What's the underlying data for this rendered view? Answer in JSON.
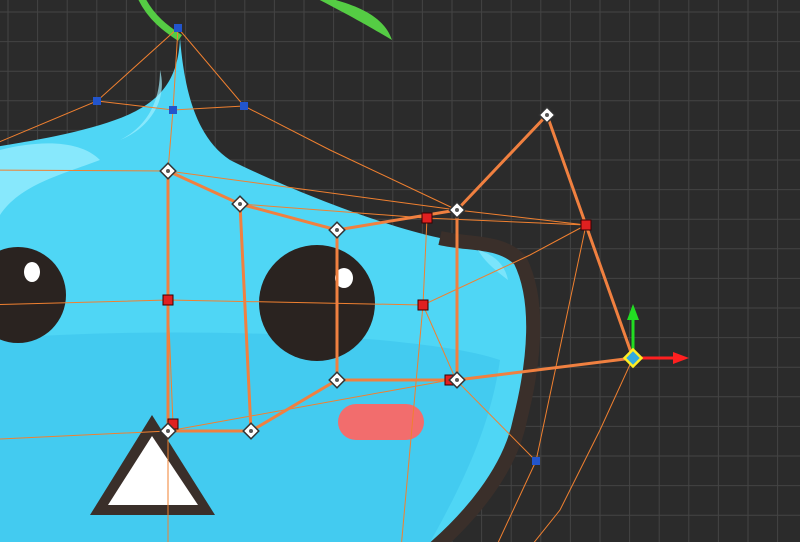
{
  "viewport": {
    "background_color": "#2b2b2b",
    "grid_color": "#444444"
  },
  "artwork": {
    "character": "slime",
    "body_color": "#4fd6f5",
    "highlight_color": "#9ff0ff",
    "outline_color": "#3a2f2a",
    "eye_color": "#2a2320",
    "mouth_color": "#f26d6d",
    "leaf_color": "#55cc44",
    "nose_marker_color": "#ffffff"
  },
  "mesh": {
    "wire_color": "#f08030",
    "polygon_color": "#f08040",
    "selected_vertex_color": "#ffffff",
    "bone_joint_color": "#e02020",
    "skin_vertex_color": "#2255cc"
  },
  "gizmo": {
    "x_axis_color": "#ff2020",
    "y_axis_color": "#22dd22",
    "handle_color": "#ffee22",
    "handle_inner_color": "#33aadd"
  }
}
